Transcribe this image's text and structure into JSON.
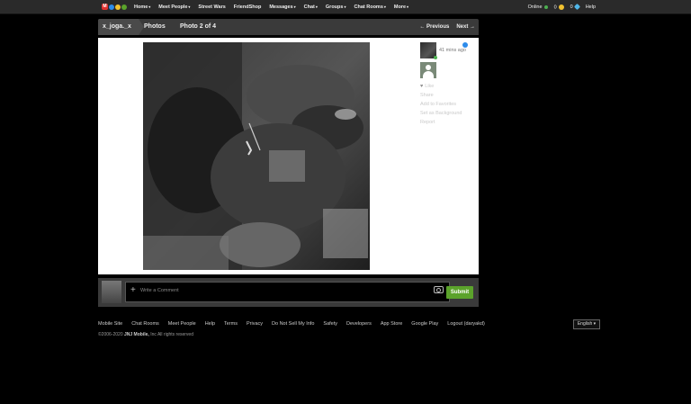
{
  "nav": {
    "items": [
      {
        "label": "Home",
        "dropdown": true
      },
      {
        "label": "Meet People",
        "dropdown": true
      },
      {
        "label": "Street Wars",
        "dropdown": false
      },
      {
        "label": "FriendShop",
        "dropdown": false
      },
      {
        "label": "Messages",
        "dropdown": true
      },
      {
        "label": "Chat",
        "dropdown": true
      },
      {
        "label": "Groups",
        "dropdown": true
      },
      {
        "label": "Chat Rooms",
        "dropdown": true
      },
      {
        "label": "More",
        "dropdown": true
      }
    ],
    "status": "Online",
    "coins": "0",
    "gems": "0",
    "help": "Help",
    "caret": "▾"
  },
  "photo_header": {
    "username": "x_joga._x",
    "section": "Photos",
    "count": "Photo 2 of 4",
    "previous": "← Previous",
    "next": "Next →"
  },
  "sidebar": {
    "time_ago": "41 mins ago",
    "actions": {
      "like": "Like",
      "share": "Share",
      "favorites": "Add to Favorites",
      "background": "Set as Background",
      "report": "Report"
    }
  },
  "comment": {
    "placeholder": "Write a Comment",
    "submit": "Submit"
  },
  "footer": {
    "links": [
      "Mobile Site",
      "Chat Rooms",
      "Meet People",
      "Help",
      "Terms",
      "Privacy",
      "Do Not Sell My Info",
      "Safety",
      "Developers",
      "App Store",
      "Google Play",
      "Logout (daryakd)"
    ],
    "copyright_prefix": "©2006-2020",
    "company": "JNJ Mobile,",
    "copyright_suffix": "Inc All rights reserved",
    "language": "English ▾"
  },
  "colors": {
    "online": "#4caf50",
    "coin": "#f2c230",
    "gem": "#4fb6e8",
    "submit": "#5ba32b"
  }
}
